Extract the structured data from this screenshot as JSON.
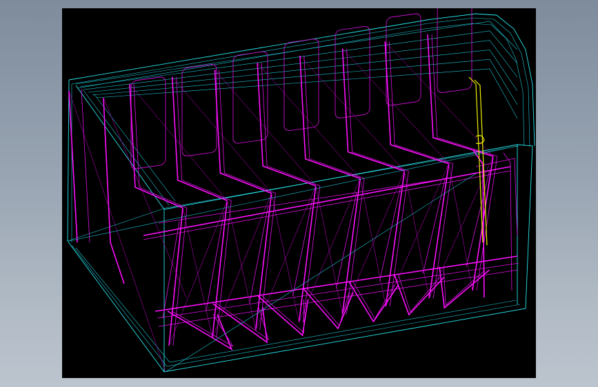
{
  "viewport": {
    "background": "#000000",
    "render_mode": "wireframe"
  },
  "model": {
    "bays": 7,
    "colors": {
      "shell_edges": "#28e8ee",
      "frames": "#ff10ff",
      "highlight": "#f4f400"
    }
  }
}
